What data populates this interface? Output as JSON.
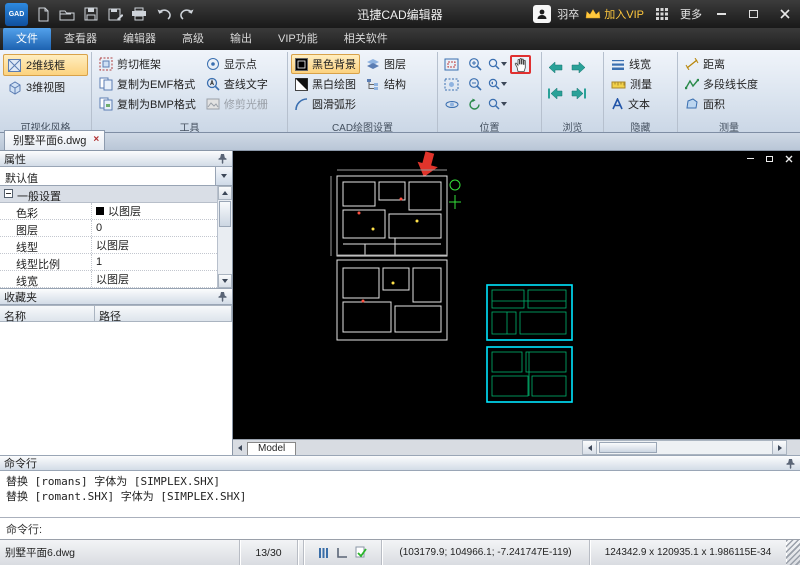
{
  "titlebar": {
    "logo_text": "GAD",
    "title": "迅捷CAD编辑器",
    "username": "羽卒",
    "vip_label": "加入VIP",
    "more_label": "更多"
  },
  "menu_tabs": {
    "file": "文件",
    "viewer": "查看器",
    "editor": "编辑器",
    "advanced": "高级",
    "output": "输出",
    "vip": "VIP功能",
    "related": "相关软件"
  },
  "ribbon": {
    "group_visual": "可视化风格",
    "btn_2d_wireframe": "2维线框",
    "btn_3d_view": "3维视图",
    "group_tools": "工具",
    "btn_clip_frame": "剪切框架",
    "btn_copy_emf": "复制为EMF格式",
    "btn_copy_bmp": "复制为BMP格式",
    "btn_show_points": "显示点",
    "btn_find_text": "查线文字",
    "btn_trim_raster": "修剪光栅",
    "group_cad": "CAD绘图设置",
    "btn_black_bg": "黑色背景",
    "btn_bw_draw": "黑白绘图",
    "btn_smooth_arc": "圆滑弧形",
    "btn_layers": "图层",
    "btn_structure": "结构",
    "group_position": "位置",
    "group_browse": "浏览",
    "group_hide": "隐藏",
    "btn_line_width": "线宽",
    "btn_measure_toggle": "测量",
    "btn_text": "文本",
    "group_measure": "测量",
    "btn_distance": "距离",
    "btn_polyline_length": "多段线长度",
    "btn_area": "面积"
  },
  "document_tab": {
    "label": "别墅平面6.dwg"
  },
  "properties_panel": {
    "title": "属性",
    "selector_value": "默认值",
    "group_label": "一般设置",
    "rows": [
      {
        "name": "色彩",
        "value": "以图层"
      },
      {
        "name": "图层",
        "value": "0"
      },
      {
        "name": "线型",
        "value": "以图层"
      },
      {
        "name": "线型比例",
        "value": "1"
      },
      {
        "name": "线宽",
        "value": "以图层"
      }
    ]
  },
  "favorites_panel": {
    "title": "收藏夹",
    "col_name": "名称",
    "col_path": "路径"
  },
  "canvas": {
    "model_tab": "Model"
  },
  "command_panel": {
    "title": "命令行",
    "history": [
      "替换 [romans] 字体为 [SIMPLEX.SHX]",
      "替换 [romant.SHX] 字体为 [SIMPLEX.SHX]"
    ],
    "prompt": "命令行:"
  },
  "statusbar": {
    "filename": "别墅平面6.dwg",
    "counter": "13/30",
    "coordinates": "(103179.9; 104966.1; -7.241747E-119)",
    "dimensions": "124342.9 x 120935.1 x 1.986115E-34"
  }
}
